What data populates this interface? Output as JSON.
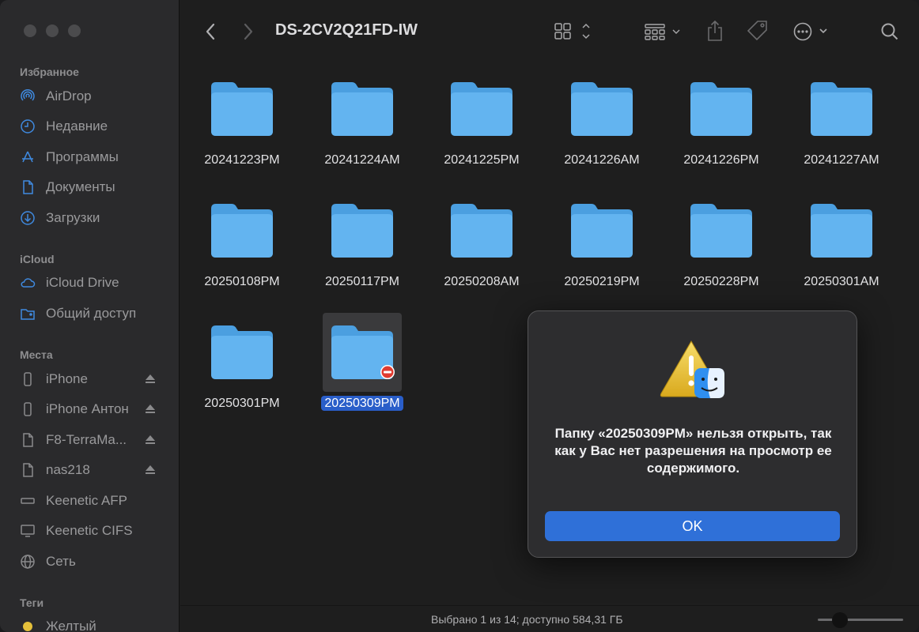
{
  "window": {
    "title": "DS-2CV2Q21FD-IW"
  },
  "sidebar": {
    "favorites_title": "Избранное",
    "favorites": [
      {
        "label": "AirDrop",
        "icon": "airdrop-icon"
      },
      {
        "label": "Недавние",
        "icon": "clock-icon"
      },
      {
        "label": "Программы",
        "icon": "apps-icon"
      },
      {
        "label": "Документы",
        "icon": "document-icon"
      },
      {
        "label": "Загрузки",
        "icon": "download-icon"
      }
    ],
    "icloud_title": "iCloud",
    "icloud": [
      {
        "label": "iCloud Drive",
        "icon": "cloud-icon"
      },
      {
        "label": "Общий доступ",
        "icon": "shared-folder-icon"
      }
    ],
    "places_title": "Места",
    "places": [
      {
        "label": "iPhone",
        "icon": "phone-icon",
        "eject": true
      },
      {
        "label": "iPhone Антон",
        "icon": "phone-icon",
        "eject": true
      },
      {
        "label": "F8-TerraMa...",
        "icon": "document-icon",
        "eject": true
      },
      {
        "label": "nas218",
        "icon": "document-icon",
        "eject": true
      },
      {
        "label": "Keenetic AFP",
        "icon": "server-icon",
        "eject": false
      },
      {
        "label": "Keenetic CIFS",
        "icon": "monitor-icon",
        "eject": false
      },
      {
        "label": "Сеть",
        "icon": "globe-icon",
        "eject": false
      }
    ],
    "tags_title": "Теги",
    "tags": [
      {
        "label": "Желтый",
        "color": "#e5c03a"
      }
    ]
  },
  "folders": [
    {
      "name": "20241223PM"
    },
    {
      "name": "20241224AM"
    },
    {
      "name": "20241225PM"
    },
    {
      "name": "20241226AM"
    },
    {
      "name": "20241226PM"
    },
    {
      "name": "20241227AM"
    },
    {
      "name": "20250108PM"
    },
    {
      "name": "20250117PM"
    },
    {
      "name": "20250208AM"
    },
    {
      "name": "20250219PM"
    },
    {
      "name": "20250228PM"
    },
    {
      "name": "20250301AM"
    },
    {
      "name": "20250301PM"
    },
    {
      "name": "20250309PM",
      "selected": true,
      "no_access": true
    }
  ],
  "status": {
    "text": "Выбрано 1 из 14; доступно 584,31 ГБ"
  },
  "alert": {
    "message": "Папку «20250309PM» нельзя открыть, так как у Вас нет разрешения на просмотр ее содержимого.",
    "ok_label": "OK"
  },
  "colors": {
    "folder": "#5aaee8",
    "accent": "#2f70d8",
    "selection": "#2a5ec9"
  }
}
